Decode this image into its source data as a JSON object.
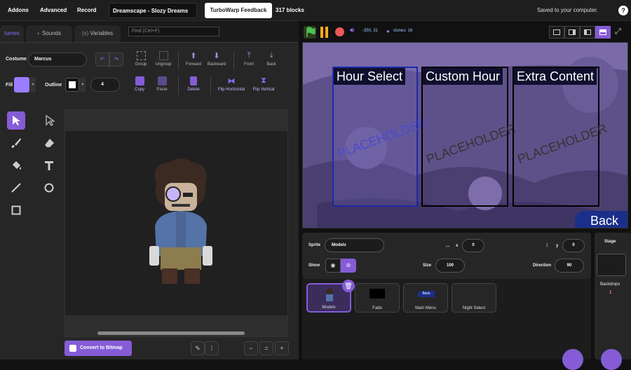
{
  "menubar": {
    "addons": "Addons",
    "advanced": "Advanced",
    "record": "Record",
    "project_title": "Dreamscape - Slozy Dreams",
    "feedback": "TurboWarp Feedback",
    "blocks_count": "317 blocks",
    "saved_status": "Saved to your computer.",
    "help": "?"
  },
  "tabs": [
    {
      "label": "tumes"
    },
    {
      "label": "Sounds"
    },
    {
      "label": "Variables",
      "prefix": "(x)"
    }
  ],
  "find": {
    "placeholder": "Find (Ctrl+F)"
  },
  "costume": {
    "label": "Costume",
    "name": "Marcus",
    "fill_label": "Fill",
    "fill_color": "#9c7cff",
    "outline_label": "Outline",
    "outline_color": "#ffffff",
    "outline_width": "4"
  },
  "toolbar": {
    "group": "Group",
    "ungroup": "Ungroup",
    "forward": "Forward",
    "backward": "Backward",
    "front": "Front",
    "back": "Back",
    "copy": "Copy",
    "paste": "Paste",
    "delete": "Delete",
    "flip_h": "Flip Horizontal",
    "flip_v": "Flip Vertical"
  },
  "tools": [
    "select-icon",
    "reshape-icon",
    "brush-icon",
    "eraser-icon",
    "fill-icon",
    "text-icon",
    "line-icon",
    "circle-icon",
    "rectangle-icon"
  ],
  "canvas": {
    "convert_btn": "Convert to Bitmap",
    "zoom_out": "−",
    "zoom_reset": "=",
    "zoom_in": "+"
  },
  "stagebar": {
    "coords": "-350, 31",
    "clones": "clones: 16"
  },
  "stage": {
    "boxes": [
      {
        "title": "Hour Select",
        "placeholder": "PLACEHOLDER"
      },
      {
        "title": "Custom Hour",
        "placeholder": "PLACEHOLDER"
      },
      {
        "title": "Extra Content",
        "placeholder": "PLACEHOLDER"
      }
    ],
    "back": "Back"
  },
  "sprite_info": {
    "sprite_label": "Sprite",
    "sprite_name": "Models",
    "x_label": "x",
    "x_value": "0",
    "y_label": "y",
    "y_value": "0",
    "show_label": "Show",
    "size_label": "Size",
    "size_value": "100",
    "direction_label": "Direction",
    "direction_value": "90"
  },
  "sprites": [
    {
      "name": "Models"
    },
    {
      "name": "Fade"
    },
    {
      "name": "Main Menu",
      "thumb_text": "Back"
    },
    {
      "name": "Night Select"
    }
  ],
  "stage_pane": {
    "title": "Stage",
    "backdrops_label": "Backdrops",
    "backdrops_count": "1"
  }
}
